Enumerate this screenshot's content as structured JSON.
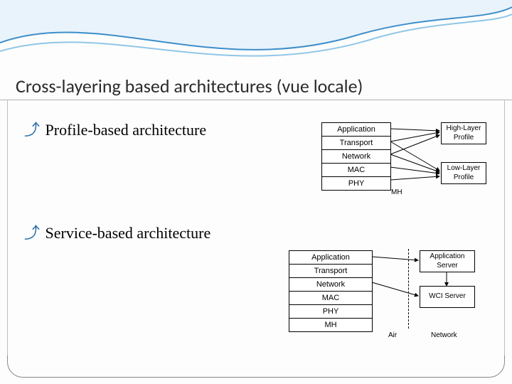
{
  "title": "Cross-layering based architectures (vue locale)",
  "bullets": {
    "b1": "Profile-based architecture",
    "b2": "Service-based architecture"
  },
  "diag1": {
    "layers": {
      "l0": "Application",
      "l1": "Transport",
      "l2": "Network",
      "l3": "MAC",
      "l4": "PHY"
    },
    "high": {
      "l1": "High-Layer",
      "l2": "Profile"
    },
    "low": {
      "l1": "Low-Layer",
      "l2": "Profile"
    },
    "mh": "MH"
  },
  "diag2": {
    "layers": {
      "l0": "Application",
      "l1": "Transport",
      "l2": "Network",
      "l3": "MAC",
      "l4": "PHY",
      "l5": "MH"
    },
    "appserver": {
      "l1": "Application",
      "l2": "Server"
    },
    "wciserver": {
      "l1": "WCI Server",
      "l2": ""
    },
    "air": "Air",
    "network": "Network"
  },
  "chart_data": [
    {
      "type": "diagram",
      "name": "Profile-based architecture",
      "left_stack": [
        "Application",
        "Transport",
        "Network",
        "MAC",
        "PHY"
      ],
      "left_stack_label": "MH",
      "right_boxes": [
        "High-Layer Profile",
        "Low-Layer Profile"
      ],
      "edges": [
        {
          "from": "Application",
          "to": "High-Layer Profile",
          "bidirectional": true
        },
        {
          "from": "Transport",
          "to": "High-Layer Profile"
        },
        {
          "from": "Transport",
          "to": "Low-Layer Profile"
        },
        {
          "from": "Network",
          "to": "High-Layer Profile"
        },
        {
          "from": "Network",
          "to": "Low-Layer Profile"
        },
        {
          "from": "MAC",
          "to": "Low-Layer Profile",
          "bidirectional": true
        },
        {
          "from": "PHY",
          "to": "Low-Layer Profile"
        }
      ]
    },
    {
      "type": "diagram",
      "name": "Service-based architecture",
      "left_stack": [
        "Application",
        "Transport",
        "Network",
        "MAC",
        "PHY",
        "MH"
      ],
      "right_boxes": [
        "Application Server",
        "WCI Server"
      ],
      "separator": "Air",
      "right_region_label": "Network",
      "edges": [
        {
          "from": "Application",
          "to": "Application Server",
          "bidirectional": true
        },
        {
          "from": "Network",
          "to": "WCI Server",
          "bidirectional": true
        },
        {
          "from": "Application Server",
          "to": "WCI Server",
          "bidirectional": true
        }
      ]
    }
  ]
}
